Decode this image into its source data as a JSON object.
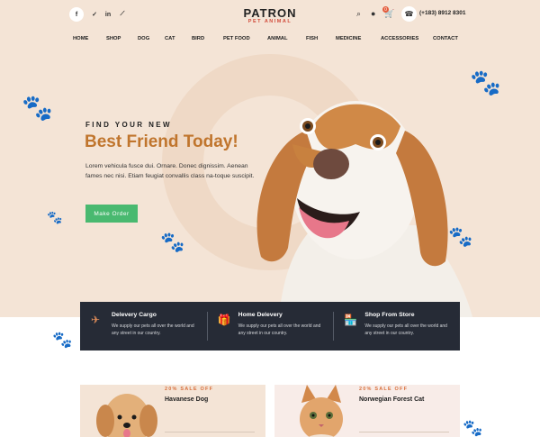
{
  "header": {
    "social": [
      {
        "icon": "facebook-icon",
        "glyph": "f"
      },
      {
        "icon": "twitter-icon",
        "glyph": "✓"
      },
      {
        "icon": "linkedin-icon",
        "glyph": "in"
      },
      {
        "icon": "rss-icon",
        "glyph": "⟋"
      }
    ],
    "logo_main": "PATRON",
    "logo_sub": "PET ANIMAL",
    "cart_count": "0",
    "phone": "(+183) 8912 8301"
  },
  "nav": [
    "HOME",
    "SHOP",
    "DOG",
    "CAT",
    "BIRD",
    "PET FOOD",
    "ANIMAL",
    "FISH",
    "MEDICINE",
    "ACCESSORIES",
    "CONTACT"
  ],
  "hero": {
    "eyebrow": "FIND YOUR NEW",
    "headline": "Best Friend Today!",
    "paragraph": "Lorem vehicula fusce dui. Ornare. Donec dignissim. Aenean fames nec nisi. Etiam feugiat convallis class na-toque suscipit.",
    "cta": "Make Order"
  },
  "features": [
    {
      "icon": "plane-icon",
      "title": "Delevery Cargo",
      "desc": "We supply our pets all over the world and any street in our country."
    },
    {
      "icon": "gift-icon",
      "title": "Home Delevery",
      "desc": "We supply our pets all over the world and any street in our country."
    },
    {
      "icon": "shop-icon",
      "title": "Shop From Store",
      "desc": "We supply our pets all over the world and any street in our country."
    }
  ],
  "products": [
    {
      "sale": "20% SALE OFF",
      "name": "Havanese Dog"
    },
    {
      "sale": "20% SALE OFF",
      "name": "Norwegian Forest Cat"
    }
  ],
  "colors": {
    "accent": "#c0752d",
    "cta": "#49b970",
    "hero_bg": "#f4e4d6",
    "feature_bg": "#262b36",
    "badge": "#e45b3b"
  }
}
